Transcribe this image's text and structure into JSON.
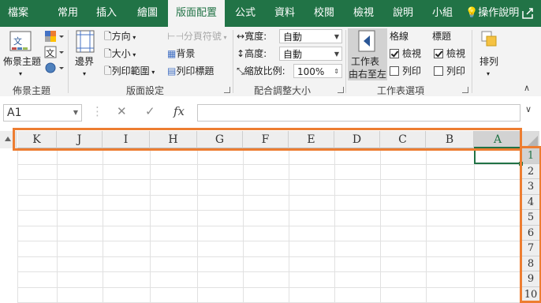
{
  "tabs": [
    "檔案",
    "常用",
    "插入",
    "繪圖",
    "版面配置",
    "公式",
    "資料",
    "校閱",
    "檢視",
    "說明",
    "小組"
  ],
  "active_tab": "版面配置",
  "tell_me": "操作說明",
  "ribbon": {
    "themes": {
      "button": "佈景主題",
      "group": "佈景主題"
    },
    "page_setup": {
      "margins": "邊界",
      "orientation": "方向",
      "size": "大小",
      "print_area": "列印範圍",
      "breaks": "分頁符號",
      "background": "背景",
      "print_titles": "列印標題",
      "group": "版面設定"
    },
    "scale": {
      "width_label": "寬度:",
      "width_value": "自動",
      "height_label": "高度:",
      "height_value": "自動",
      "scale_label": "縮放比例:",
      "scale_value": "100%",
      "group": "配合調整大小"
    },
    "sheet_options": {
      "rtl_line1": "工作表",
      "rtl_line2": "由右至左",
      "gridlines": "格線",
      "headings": "標題",
      "view": "檢視",
      "print": "列印",
      "group": "工作表選項"
    },
    "arrange": {
      "button": "排列"
    }
  },
  "formula_bar": {
    "name_box": "A1",
    "fx": "fx",
    "cancel": "✕",
    "enter": "✓"
  },
  "columns": [
    "K",
    "J",
    "I",
    "H",
    "G",
    "F",
    "E",
    "D",
    "C",
    "B",
    "A"
  ],
  "rows": [
    "1",
    "2",
    "3",
    "4",
    "5",
    "6",
    "7",
    "8",
    "9",
    "10"
  ],
  "selected_cell": "A1",
  "colors": {
    "accent": "#217346",
    "highlight": "#ed7d31"
  }
}
